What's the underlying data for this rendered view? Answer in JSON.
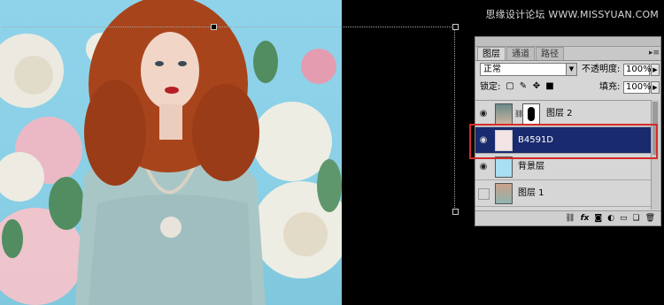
{
  "watermark": "思缘设计论坛 WWW.MISSYUAN.COM",
  "panel": {
    "tabs": [
      {
        "label": "图层",
        "active": true
      },
      {
        "label": "通道",
        "active": false
      },
      {
        "label": "路径",
        "active": false
      }
    ],
    "blend_mode": "正常",
    "opacity_label": "不透明度:",
    "opacity_value": "100%",
    "lock_label": "锁定:",
    "fill_label": "填充:",
    "fill_value": "100%",
    "layers": [
      {
        "name": "图层 2",
        "visible": true,
        "selected": false,
        "has_mask": true
      },
      {
        "name": "B4591D",
        "visible": true,
        "selected": true,
        "has_mask": false
      },
      {
        "name": "背景层",
        "visible": true,
        "selected": false,
        "has_mask": false
      },
      {
        "name": "图层 1",
        "visible": false,
        "selected": false,
        "has_mask": false
      }
    ],
    "bottom_icons": [
      "link-icon",
      "fx-icon",
      "mask-icon",
      "adjustment-icon",
      "group-icon",
      "new-layer-icon",
      "trash-icon"
    ]
  },
  "colors": {
    "selected_layer": "#1a2a6e",
    "highlight_box": "#d62a2a",
    "sky": "#8fd3ea"
  }
}
